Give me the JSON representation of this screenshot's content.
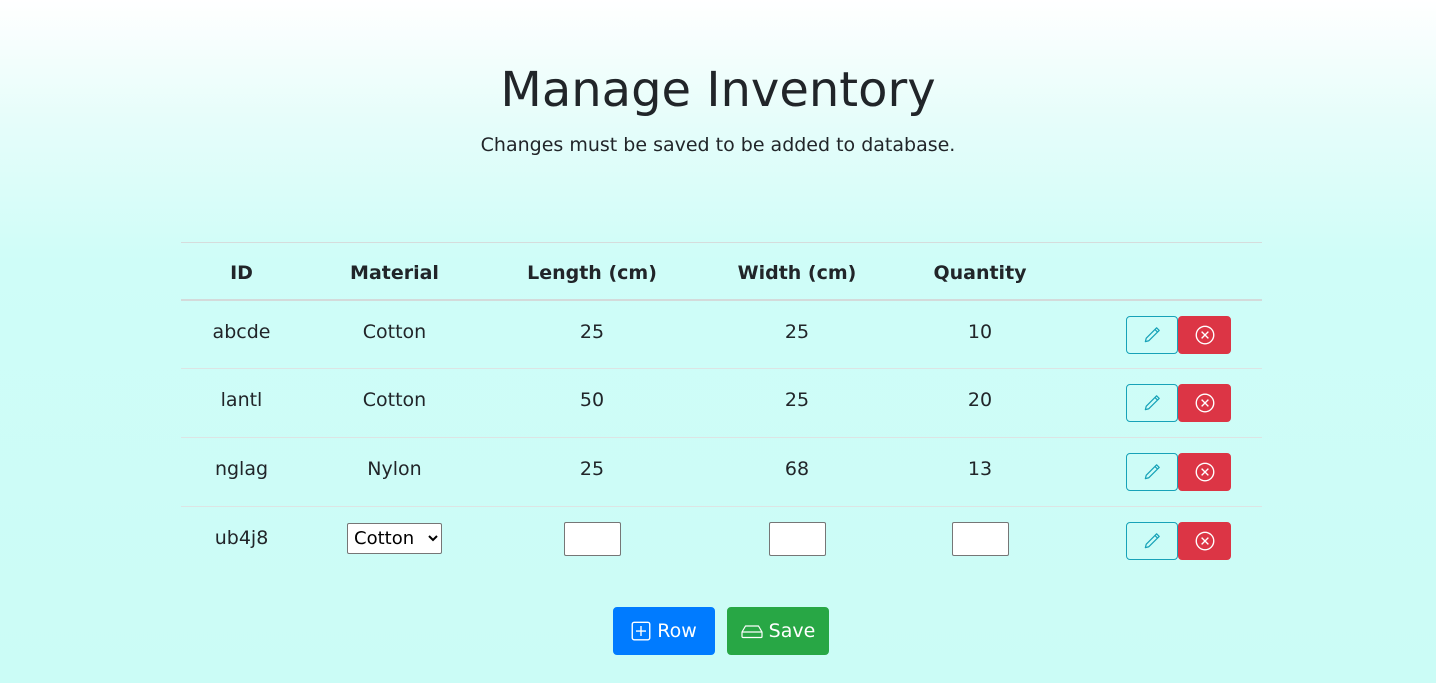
{
  "page": {
    "title": "Manage Inventory",
    "subtitle": "Changes must be saved to be added to database."
  },
  "table": {
    "headers": {
      "id": "ID",
      "material": "Material",
      "length": "Length (cm)",
      "width": "Width (cm)",
      "quantity": "Quantity"
    },
    "rows": [
      {
        "id": "abcde",
        "material": "Cotton",
        "length": "25",
        "width": "25",
        "quantity": "10"
      },
      {
        "id": "lantl",
        "material": "Cotton",
        "length": "50",
        "width": "25",
        "quantity": "20"
      },
      {
        "id": "nglag",
        "material": "Nylon",
        "length": "25",
        "width": "68",
        "quantity": "13"
      }
    ],
    "edit_row": {
      "id": "ub4j8",
      "material_selected": "Cotton",
      "length_value": "",
      "width_value": "",
      "quantity_value": ""
    }
  },
  "buttons": {
    "row_label": "Row",
    "save_label": "Save"
  },
  "icons": {
    "edit": "pencil-icon",
    "delete": "x-circle-icon",
    "add_row": "plus-square-icon",
    "save": "hdd-icon"
  },
  "colors": {
    "primary": "#007bff",
    "success": "#28a745",
    "danger": "#dc3545",
    "info": "#17a2b8"
  }
}
